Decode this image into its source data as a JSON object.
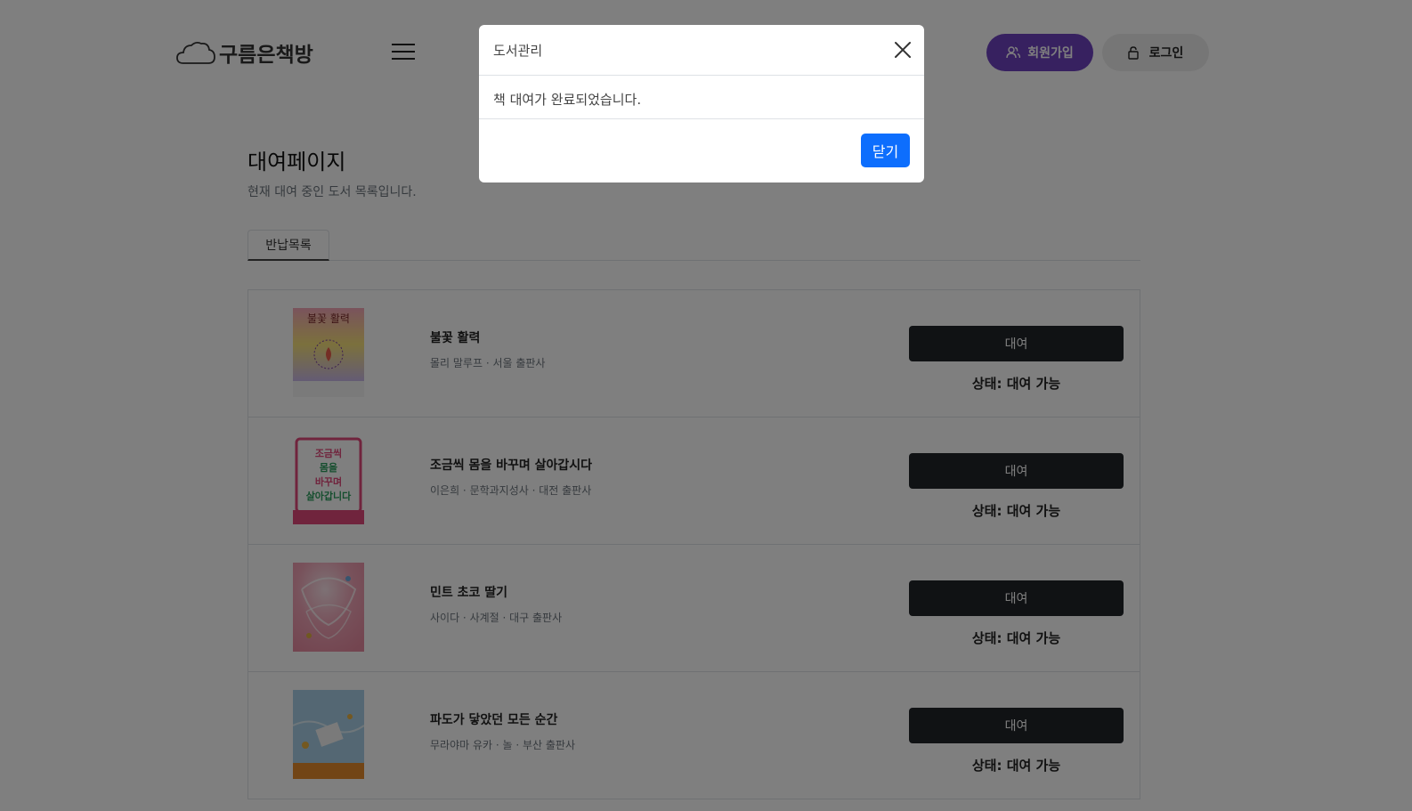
{
  "header": {
    "logo_text": "구름은책방",
    "signup_label": "회원가입",
    "login_label": "로그인",
    "signup_color": "#6f42c1"
  },
  "main": {
    "title": "대여페이지",
    "subtitle": "현재 대여 중인 도서 목록입니다.",
    "tab_label": "반납목록"
  },
  "books": [
    {
      "title": "불꽃 활력",
      "meta": "몰리 말루프 · 서울 출판사",
      "button": "대여",
      "status": "상태: 대여 가능",
      "cover_text": "불꽃 활력"
    },
    {
      "title": "조금씩 몸을 바꾸며 살아갑시다",
      "meta": "이은희 · 문학과지성사 · 대전 출판사",
      "button": "대여",
      "status": "상태: 대여 가능",
      "cover_text": "조금씩 몸을 바꾸며 살아갑니다"
    },
    {
      "title": "민트 초코 딸기",
      "meta": "사이다 · 사계절 · 대구 출판사",
      "button": "대여",
      "status": "상태: 대여 가능"
    },
    {
      "title": "파도가 닿았던 모든 순간",
      "meta": "무라야마 유카 · 놀 · 부산 출판사",
      "button": "대여",
      "status": "상태: 대여 가능"
    }
  ],
  "modal": {
    "title": "도서관리",
    "message": "책 대여가 완료되었습니다.",
    "ok_label": "닫기",
    "ok_color": "#0d6efd"
  }
}
